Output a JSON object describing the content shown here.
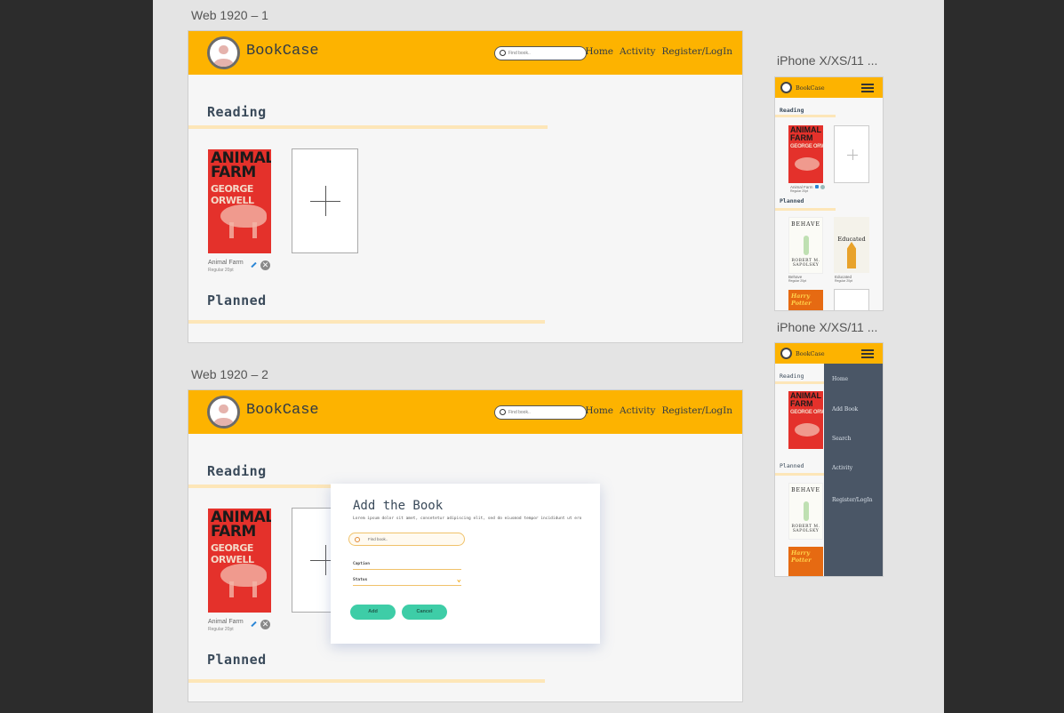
{
  "artboards": {
    "web1": "Web 1920 – 1",
    "web2": "Web 1920 – 2",
    "phone1": "iPhone X/XS/11 ...",
    "phone2": "iPhone X/XS/11 ..."
  },
  "header": {
    "brand": "BookCase",
    "search_placeholder": "Find book..",
    "nav": [
      "Home",
      "Activity",
      "Register/LogIn"
    ]
  },
  "sections": {
    "reading": "Reading",
    "planned": "Planned"
  },
  "book": {
    "cover_title": "ANIMAL FARM",
    "cover_author": "GEORGE ORWELL",
    "caption_title": "Animal Farm",
    "caption_sub": "Regular 20pt"
  },
  "modal": {
    "title": "Add the Book",
    "description": "Lorem ipsum dolor sit amet, consetetur adipiscing elit, sed do eiusmod tempor incididunt ut ero",
    "search_placeholder": "Find book..",
    "caption_label": "Caption",
    "status_label": "Status",
    "add": "Add",
    "cancel": "Cancel"
  },
  "phone": {
    "brand": "BookCase",
    "book1": {
      "title": "Animal Farm",
      "sub": "Regular 20pt"
    },
    "behave": {
      "cover_title": "BEHAVE",
      "cover_author": "ROBERT M. SAPOLSKY",
      "title": "Behave",
      "sub": "Regular 20pt"
    },
    "educated": {
      "cover_title": "Educated",
      "title": "Educated",
      "sub": "Regular 20pt"
    },
    "hp_cover": "Harry Potter",
    "drawer": [
      "Home",
      "Add Book",
      "Search",
      "Activity",
      "Register/LogIn"
    ]
  },
  "colors": {
    "header": "#fdb300",
    "accent_underline": "#fde6b8",
    "button": "#3ecda7",
    "drawer": "#4a5666",
    "cover_red": "#e4312b"
  }
}
